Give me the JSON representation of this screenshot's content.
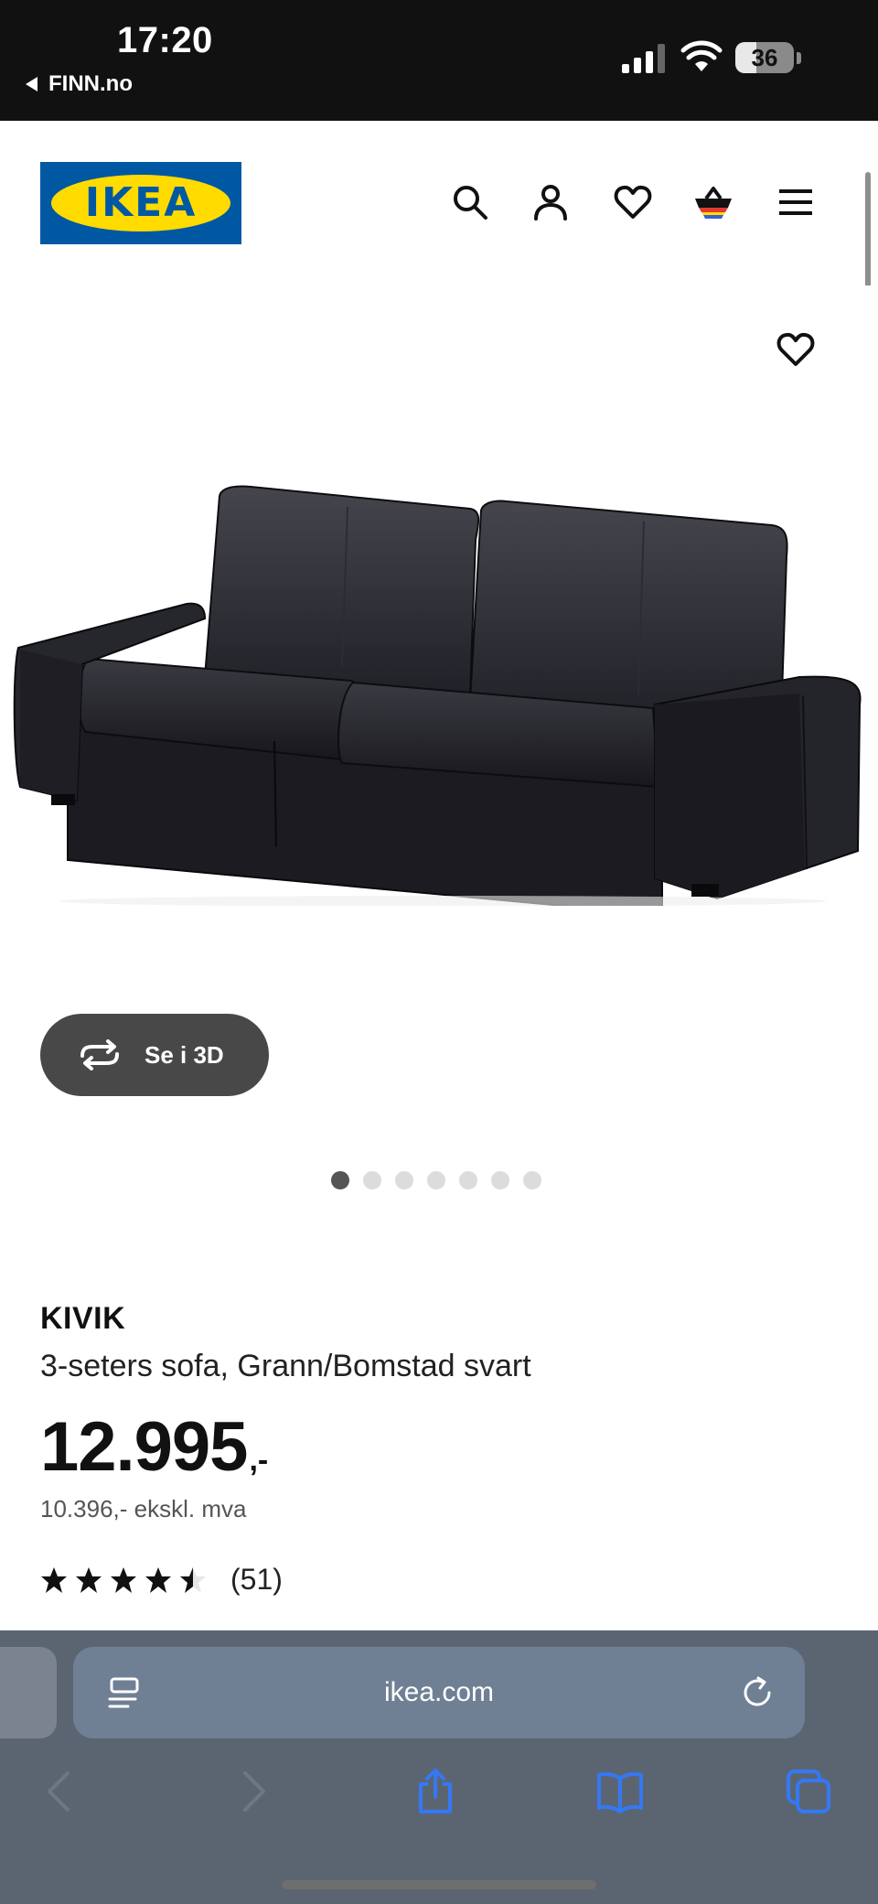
{
  "status_bar": {
    "time": "17:20",
    "back_label": "FINN.no",
    "battery": "36"
  },
  "header": {
    "logo_text": "IKEA",
    "brand_color": "#0058a3",
    "brand_yellow": "#ffdb00",
    "icons": [
      "search-icon",
      "account-icon",
      "favourites-icon",
      "shopping-bag-icon",
      "menu-icon"
    ]
  },
  "gallery": {
    "view_3d_label": "Se i 3D",
    "image_count": 7,
    "active_image": 1
  },
  "product": {
    "name": "KIVIK",
    "description": "3-seters sofa, Grann/Bomstad svart",
    "price": "12.995",
    "price_suffix": ",-",
    "price_ex_vat": "10.396,- ekskl. mva",
    "rating": 4.5,
    "rating_max": 5,
    "review_count": "(51)"
  },
  "browser": {
    "url": "ikea.com",
    "accent_color": "#3478f6"
  }
}
